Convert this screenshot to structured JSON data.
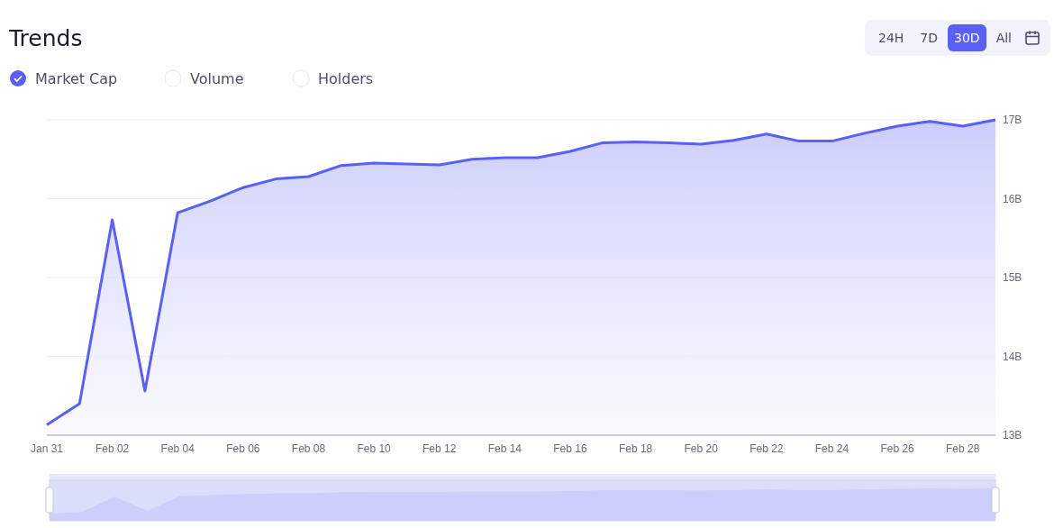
{
  "title": "Trends",
  "metrics": [
    {
      "label": "Market Cap",
      "selected": true
    },
    {
      "label": "Volume",
      "selected": false
    },
    {
      "label": "Holders",
      "selected": false
    }
  ],
  "range_options": [
    {
      "label": "24H",
      "selected": false
    },
    {
      "label": "7D",
      "selected": false
    },
    {
      "label": "30D",
      "selected": true
    },
    {
      "label": "All",
      "selected": false
    }
  ],
  "chart_data": {
    "type": "area",
    "grid": true,
    "ylim": [
      13,
      17
    ],
    "categories": [
      "Jan 31",
      null,
      "Feb 02",
      null,
      "Feb 04",
      null,
      "Feb 06",
      null,
      "Feb 08",
      null,
      "Feb 10",
      null,
      "Feb 12",
      null,
      "Feb 14",
      null,
      "Feb 16",
      null,
      "Feb 18",
      null,
      "Feb 20",
      null,
      "Feb 22",
      null,
      "Feb 24",
      null,
      "Feb 26",
      null,
      "Feb 28",
      null
    ],
    "series": [
      {
        "color": "#5a5ff5",
        "values": [
          13.13,
          13.4,
          15.73,
          13.56,
          15.82,
          15.97,
          16.14,
          16.25,
          16.28,
          16.42,
          16.45,
          16.44,
          16.43,
          16.5,
          16.52,
          16.52,
          16.6,
          16.71,
          16.72,
          16.71,
          16.69,
          16.74,
          16.82,
          16.73,
          16.73,
          16.83,
          16.92,
          16.98,
          16.92,
          17.0
        ]
      }
    ],
    "yticks": [
      {
        "value": 13,
        "label": "13B"
      },
      {
        "value": 14,
        "label": "14B"
      },
      {
        "value": 15,
        "label": "15B"
      },
      {
        "value": 16,
        "label": "16B"
      },
      {
        "value": 17,
        "label": "17B"
      }
    ]
  }
}
